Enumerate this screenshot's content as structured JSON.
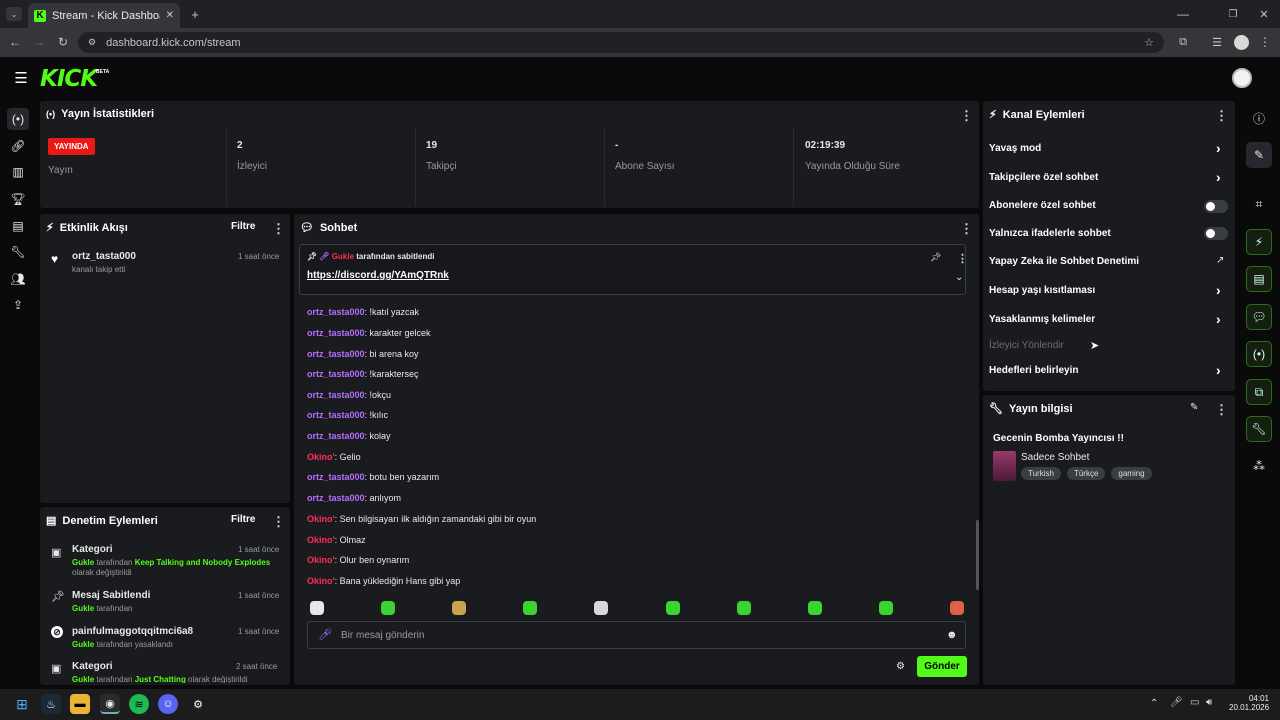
{
  "browser": {
    "tab_title": "Stream - Kick Dashboard",
    "new_tab": "+",
    "url": "dashboard.kick.com/stream"
  },
  "app": {
    "logo": "KICK",
    "beta": "BETA"
  },
  "stats": {
    "title": "Yayın İstatistikleri",
    "live_badge": "YAYINDA",
    "items": [
      {
        "value": "",
        "label": "Yayın"
      },
      {
        "value": "2",
        "label": "İzleyici"
      },
      {
        "value": "19",
        "label": "Takipçi"
      },
      {
        "value": "-",
        "label": "Abone Sayısı"
      },
      {
        "value": "02:19:39",
        "label": "Yayında Olduğu Süre"
      }
    ]
  },
  "activity": {
    "title": "Etkinlik Akışı",
    "filter": "Filtre",
    "items": [
      {
        "user": "ortz_tasta000",
        "desc": "kanalı takip etti",
        "time": "1 saat önce"
      }
    ]
  },
  "moderation": {
    "title": "Denetim Eylemleri",
    "filter": "Filtre",
    "items": [
      {
        "title": "Kategori",
        "time": "1 saat önce",
        "actor": "Gukle",
        "mid": " tarafından ",
        "target": "Keep Talking and Nobody Explodes",
        "tail": "olarak değiştirildi"
      },
      {
        "title": "Mesaj Sabitlendi",
        "time": "1 saat önce",
        "actor": "Gukle",
        "mid": " tarafından",
        "target": "",
        "tail": ""
      },
      {
        "title": "painfulmaggotqqitmci6a8",
        "time": "1 saat önce",
        "actor": "Gukle",
        "mid": " tarafından yasaklandı",
        "target": "",
        "tail": ""
      },
      {
        "title": "Kategori",
        "time": "2 saat önce",
        "actor": "Gukle",
        "mid": " tarafından ",
        "target": "Just Chatting",
        "tail": " olarak değiştirildi"
      }
    ]
  },
  "chat": {
    "title": "Sohbet",
    "pinned_by": "Gukle",
    "pinned_text": " tarafından sabitlendi",
    "pinned_link": "https://discord.gg/YAmQTRnk",
    "messages": [
      {
        "user": "ortz_tasta000",
        "text": ": !katıl yazcak",
        "role": "purple"
      },
      {
        "user": "ortz_tasta000",
        "text": ": karakter gelcek",
        "role": "purple"
      },
      {
        "user": "ortz_tasta000",
        "text": ": bi arena koy",
        "role": "purple"
      },
      {
        "user": "ortz_tasta000",
        "text": ": !karakterseç",
        "role": "purple"
      },
      {
        "user": "ortz_tasta000",
        "text": ": !okçu",
        "role": "purple"
      },
      {
        "user": "ortz_tasta000",
        "text": ": !kılıc",
        "role": "purple"
      },
      {
        "user": "ortz_tasta000",
        "text": ": kolay",
        "role": "purple"
      },
      {
        "user": "Okino'",
        "text": ": Gelio",
        "role": "red"
      },
      {
        "user": "ortz_tasta000",
        "text": ": botu ben yazarım",
        "role": "purple"
      },
      {
        "user": "ortz_tasta000",
        "text": ": anlıyom",
        "role": "purple"
      },
      {
        "user": "Okino'",
        "text": ": Sen bilgisayarı ilk aldığın zamandaki gibi bir oyun",
        "role": "red"
      },
      {
        "user": "Okino'",
        "text": ": Olmaz",
        "role": "red"
      },
      {
        "user": "Okino'",
        "text": ": Olur ben oynarım",
        "role": "red"
      },
      {
        "user": "Okino'",
        "text": ": Bana yüklediğin Hans gibi yap",
        "role": "red"
      }
    ],
    "input_placeholder": "Bir mesaj gönderin",
    "send": "Gönder"
  },
  "channel_actions": {
    "title": "Kanal Eylemleri",
    "items": [
      {
        "label": "Yavaş mod",
        "kind": "chevron"
      },
      {
        "label": "Takipçilere özel sohbet",
        "kind": "chevron"
      },
      {
        "label": "Abonelere özel sohbet",
        "kind": "toggle"
      },
      {
        "label": "Yalnızca ifadelerle sohbet",
        "kind": "toggle"
      },
      {
        "label": "Yapay Zeka ile Sohbet Denetimi",
        "kind": "external"
      },
      {
        "label": "Hesap yaşı kısıtlaması",
        "kind": "chevron"
      },
      {
        "label": "Yasaklanmış kelimeler",
        "kind": "chevron"
      },
      {
        "label": "İzleyici Yönlendir",
        "kind": "disabled"
      },
      {
        "label": "Hedefleri belirleyin",
        "kind": "chevron"
      }
    ]
  },
  "stream_info": {
    "title": "Yayın bilgisi",
    "stream_title": "Gecenin Bomba Yayıncısı !!",
    "category": "Sadece Sohbet",
    "tags": [
      "Turkish",
      "Türkçe",
      "gaming"
    ]
  },
  "taskbar": {
    "time": "04:01",
    "date": "20.01.2026"
  },
  "colors": {
    "accent": "#53fc18",
    "live": "#e91916",
    "panel": "#191b1f"
  }
}
